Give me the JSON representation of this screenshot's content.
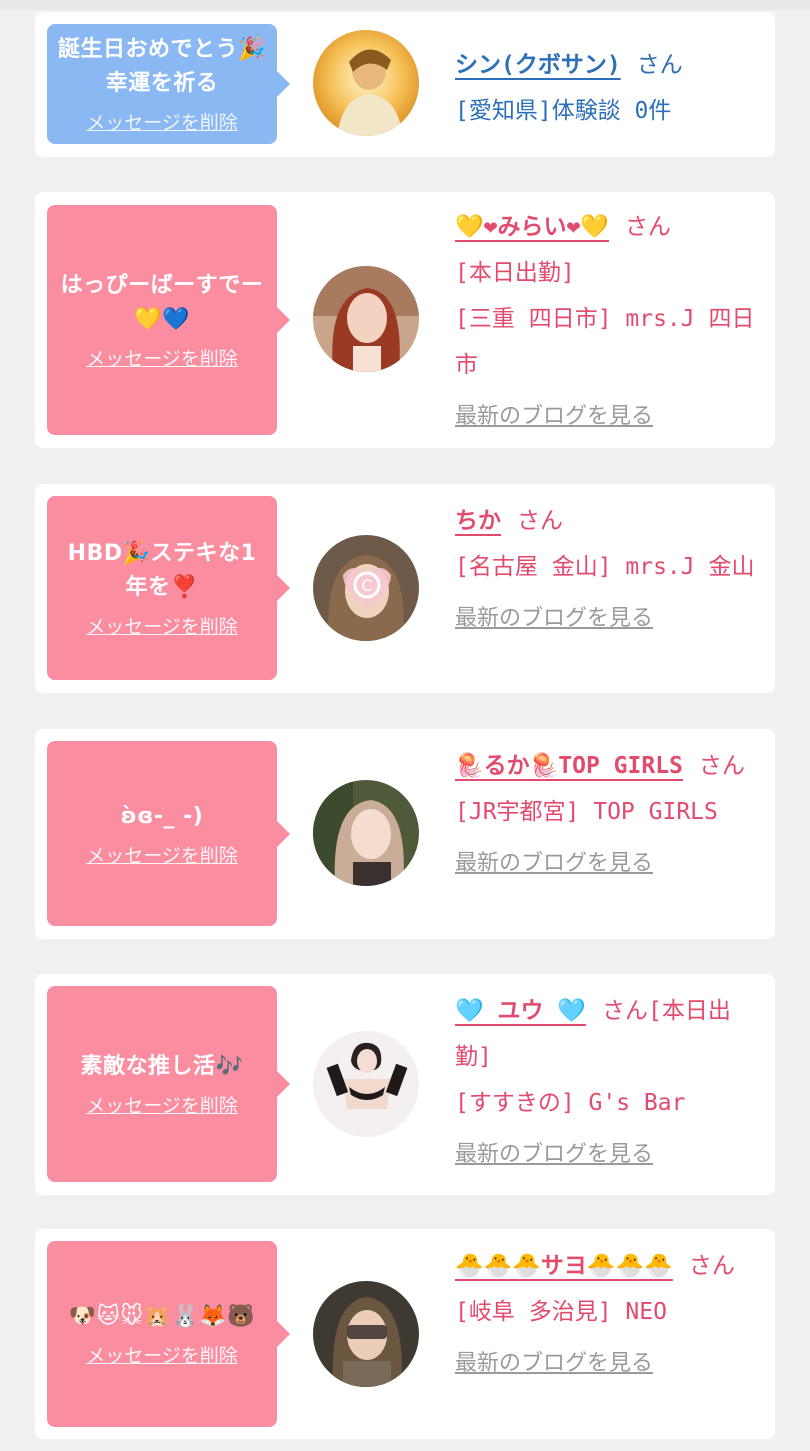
{
  "cards": [
    {
      "message": "誕生日おめでとう🎉幸運を祈る",
      "delete_label": "メッセージを削除",
      "name": "シン(クボサン)",
      "honorific": "さん",
      "lines": [
        "[愛知県]体験談 0件"
      ],
      "blog_label": ""
    },
    {
      "message": "はっぴーばーすでー💛💙",
      "delete_label": "メッセージを削除",
      "name": "💛❤みらい❤💛",
      "honorific": "さん",
      "lines": [
        "[本日出勤]",
        "[三重 四日市] mrs.J 四日市"
      ],
      "blog_label": "最新のブログを見る"
    },
    {
      "message": "HBD🎉ステキな1年を❣️",
      "delete_label": "メッセージを削除",
      "name": "ちか",
      "honorific": "さん",
      "lines": [
        "[名古屋 金山] mrs.J 金山"
      ],
      "blog_label": "最新のブログを見る"
    },
    {
      "message": "ʚ̀ɞ-_ -)",
      "delete_label": "メッセージを削除",
      "name": "🪼るか🪼TOP GIRLS",
      "honorific": "さん",
      "lines": [
        "[JR宇都宮] TOP GIRLS"
      ],
      "blog_label": "最新のブログを見る"
    },
    {
      "message": "素敵な推し活🎶",
      "delete_label": "メッセージを削除",
      "name": "🩵 ユウ 🩵",
      "honorific": "さん[本日出勤]",
      "lines": [
        "[すすきの] G's Bar"
      ],
      "blog_label": "最新のブログを見る"
    },
    {
      "message": "🐶🐱🐭🐹🐰🦊🐻",
      "delete_label": "メッセージを削除",
      "name": "🐣🐣🐣サヨ🐣🐣🐣",
      "honorific": "さん",
      "lines": [
        "[岐阜 多治見] NEO"
      ],
      "blog_label": "最新のブログを見る"
    }
  ]
}
